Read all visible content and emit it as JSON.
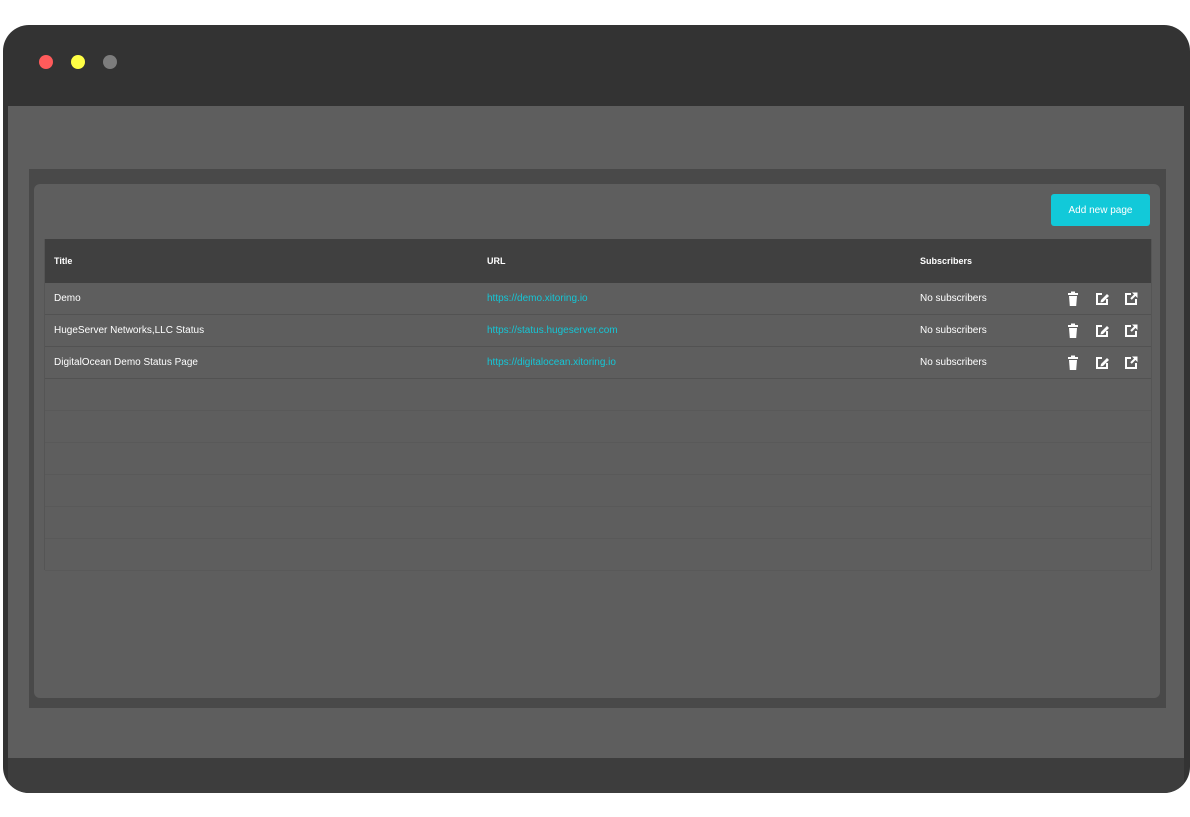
{
  "window": {
    "controls": [
      "close",
      "minimize",
      "zoom"
    ]
  },
  "toolbar": {
    "add_label": "Add new page"
  },
  "table": {
    "headers": {
      "title": "Title",
      "url": "URL",
      "subscribers": "Subscribers"
    },
    "rows": [
      {
        "title": "Demo",
        "url": "https://demo.xitoring.io",
        "subscribers": "No subscribers"
      },
      {
        "title": "HugeServer Networks,LLC Status",
        "url": "https://status.hugeserver.com",
        "subscribers": "No subscribers"
      },
      {
        "title": "DigitalOcean Demo Status Page",
        "url": "https://digitalocean.xitoring.io",
        "subscribers": "No subscribers"
      }
    ],
    "row_actions": [
      "trash-icon",
      "edit-icon",
      "external-link-icon"
    ]
  },
  "colors": {
    "accent": "#12c9d9",
    "link": "#15c6d6",
    "close": "#ff5b5b",
    "minimize": "#ffff45",
    "zoom": "#7d7d7d"
  }
}
